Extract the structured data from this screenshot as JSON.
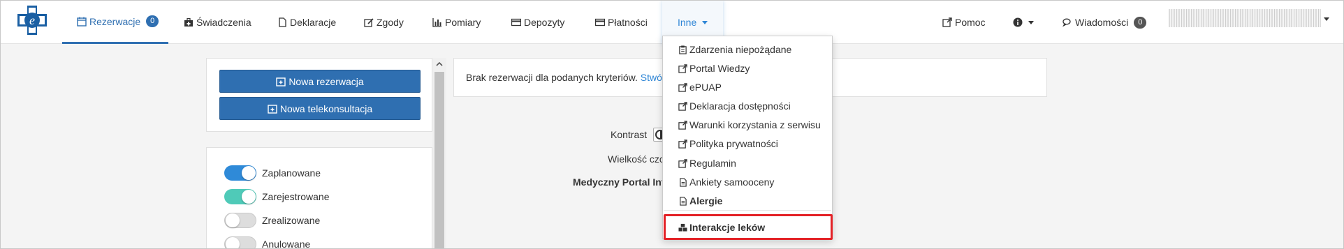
{
  "nav": {
    "items": [
      {
        "label": "Rezerwacje",
        "badge": "0",
        "icon": "calendar-icon"
      },
      {
        "label": "Świadczenia",
        "icon": "medkit-icon"
      },
      {
        "label": "Deklaracje",
        "icon": "file-icon"
      },
      {
        "label": "Zgody",
        "icon": "edit-icon"
      },
      {
        "label": "Pomiary",
        "icon": "bar-chart-icon"
      },
      {
        "label": "Depozyty",
        "icon": "credit-card-icon"
      },
      {
        "label": "Płatności",
        "icon": "credit-card-icon"
      },
      {
        "label": "Inne",
        "icon": "caret-down-icon"
      }
    ],
    "right": {
      "help_label": "Pomoc",
      "messages_label": "Wiadomości",
      "messages_badge": "0"
    }
  },
  "left": {
    "new_reservation": "Nowa rezerwacja",
    "new_teleconsultation": "Nowa telekonsultacja",
    "filters": [
      {
        "label": "Zaplanowane",
        "state": "on",
        "color": "#2f8ad8"
      },
      {
        "label": "Zarejestrowane",
        "state": "on",
        "color": "#4fcab8"
      },
      {
        "label": "Zrealizowane",
        "state": "off"
      },
      {
        "label": "Anulowane",
        "state": "off"
      }
    ]
  },
  "main": {
    "info_text": "Brak rezerwacji dla podanych kryteriów.",
    "info_link": "Stwórz",
    "contrast_label": "Kontrast",
    "font_size_label": "Wielkość czci",
    "portal_label": "Medyczny Portal Info"
  },
  "dropdown": {
    "items": [
      {
        "label": "Zdarzenia niepożądane",
        "icon": "clipboard-icon"
      },
      {
        "label": "Portal Wiedzy",
        "icon": "external-link-icon"
      },
      {
        "label": "ePUAP",
        "icon": "external-link-icon"
      },
      {
        "label": "Deklaracja dostępności",
        "icon": "external-link-icon"
      },
      {
        "label": "Warunki korzystania z serwisu",
        "icon": "external-link-icon"
      },
      {
        "label": "Polityka prywatności",
        "icon": "external-link-icon"
      },
      {
        "label": "Regulamin",
        "icon": "external-link-icon"
      },
      {
        "label": "Ankiety samooceny",
        "icon": "file-text-icon"
      },
      {
        "label": "Alergie",
        "icon": "file-text-icon"
      },
      {
        "label": "Interakcje leków",
        "icon": "cubes-icon"
      }
    ]
  },
  "colors": {
    "primary": "#2f6fb1",
    "link": "#2f86d6",
    "highlight": "#e32227"
  }
}
